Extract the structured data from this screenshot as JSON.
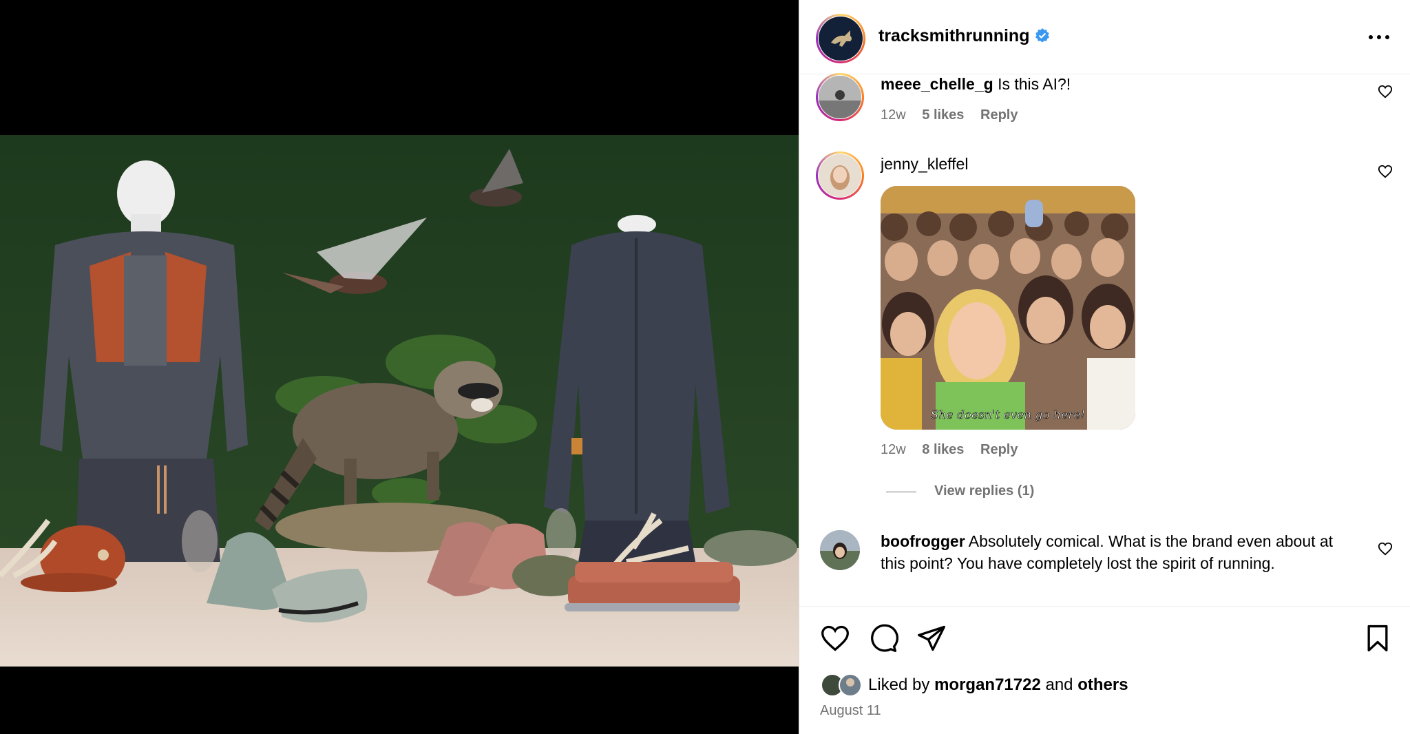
{
  "post": {
    "username": "tracksmithrunning",
    "date": "August 11",
    "liked_by_prefix": "Liked by",
    "liked_by_user": "morgan71722",
    "liked_by_and": "and",
    "liked_by_others": "others"
  },
  "comments": [
    {
      "username": "meee_chelle_g",
      "text": "Is this AI?!",
      "time": "12w",
      "likes": "5 likes",
      "reply": "Reply"
    },
    {
      "username": "jenny_kleffel",
      "gif_caption": "She doesn't even go here!",
      "time": "12w",
      "likes": "8 likes",
      "reply": "Reply",
      "view_replies": "View replies (1)"
    },
    {
      "username": "boofrogger",
      "text": "Absolutely comical. What is the brand even about at this point? You have completely lost the spirit of running."
    }
  ],
  "icons": {
    "verified": "verified-badge-icon",
    "more": "more-options-icon",
    "like": "heart-icon",
    "comment": "comment-icon",
    "share": "share-icon",
    "save": "bookmark-icon"
  },
  "colors": {
    "verified": "#3897f0",
    "meta_text": "#737373",
    "photo_backdrop": "#1f3a1e"
  }
}
